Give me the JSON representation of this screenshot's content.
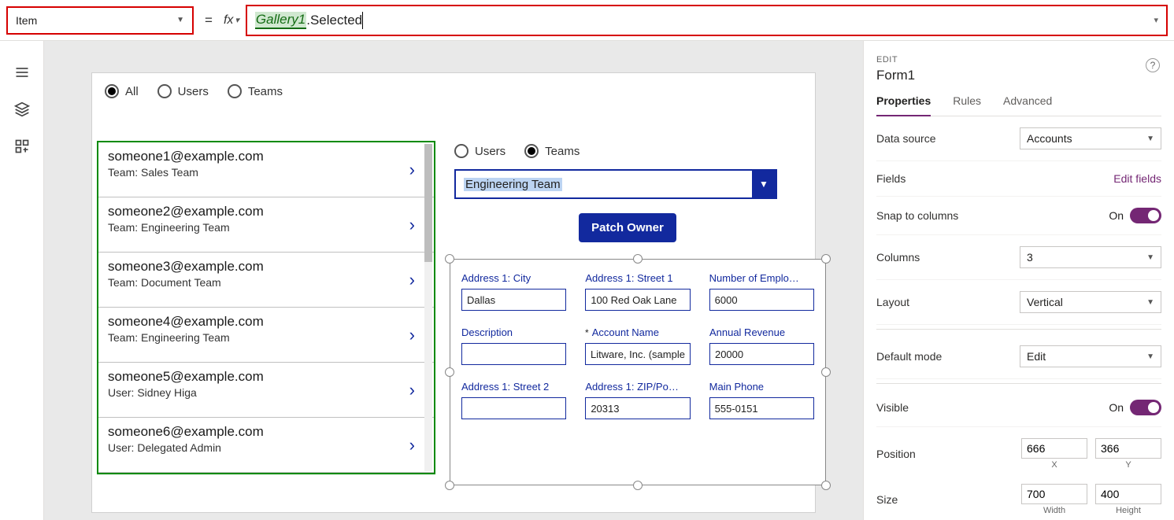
{
  "formula_bar": {
    "property": "Item",
    "fx_label": "fx",
    "highlight": "Gallery1",
    "rest": ".Selected",
    "equals": "="
  },
  "canvas": {
    "filter_radios": {
      "all": "All",
      "users": "Users",
      "teams": "Teams",
      "selected": "all"
    },
    "gallery": [
      {
        "title": "someone1@example.com",
        "sub": "Team: Sales Team"
      },
      {
        "title": "someone2@example.com",
        "sub": "Team: Engineering Team"
      },
      {
        "title": "someone3@example.com",
        "sub": "Team: Document Team"
      },
      {
        "title": "someone4@example.com",
        "sub": "Team: Engineering Team"
      },
      {
        "title": "someone5@example.com",
        "sub": "User: Sidney Higa"
      },
      {
        "title": "someone6@example.com",
        "sub": "User: Delegated Admin"
      }
    ],
    "right_radios": {
      "users": "Users",
      "teams": "Teams",
      "selected": "teams"
    },
    "combo_value": "Engineering Team",
    "patch_label": "Patch Owner",
    "form_fields": {
      "r1": [
        {
          "label": "Address 1: City",
          "value": "Dallas"
        },
        {
          "label": "Address 1: Street 1",
          "value": "100 Red Oak Lane"
        },
        {
          "label": "Number of Emplo…",
          "value": "6000"
        }
      ],
      "r2": [
        {
          "label": "Description",
          "value": ""
        },
        {
          "label": "Account Name",
          "value": "Litware, Inc. (sample",
          "required": true
        },
        {
          "label": "Annual Revenue",
          "value": "20000"
        }
      ],
      "r3": [
        {
          "label": "Address 1: Street 2",
          "value": ""
        },
        {
          "label": "Address 1: ZIP/Po…",
          "value": "20313"
        },
        {
          "label": "Main Phone",
          "value": "555-0151"
        }
      ]
    }
  },
  "right_panel": {
    "edit_label": "EDIT",
    "title": "Form1",
    "tabs": {
      "properties": "Properties",
      "rules": "Rules",
      "advanced": "Advanced"
    },
    "data_source": {
      "label": "Data source",
      "value": "Accounts"
    },
    "fields": {
      "label": "Fields",
      "link": "Edit fields"
    },
    "snap": {
      "label": "Snap to columns",
      "state": "On"
    },
    "columns": {
      "label": "Columns",
      "value": "3"
    },
    "layout": {
      "label": "Layout",
      "value": "Vertical"
    },
    "default_mode": {
      "label": "Default mode",
      "value": "Edit"
    },
    "visible": {
      "label": "Visible",
      "state": "On"
    },
    "position": {
      "label": "Position",
      "x": "666",
      "y": "366",
      "xlabel": "X",
      "ylabel": "Y"
    },
    "size": {
      "label": "Size",
      "w": "700",
      "h": "400",
      "wlabel": "Width",
      "hlabel": "Height"
    }
  }
}
